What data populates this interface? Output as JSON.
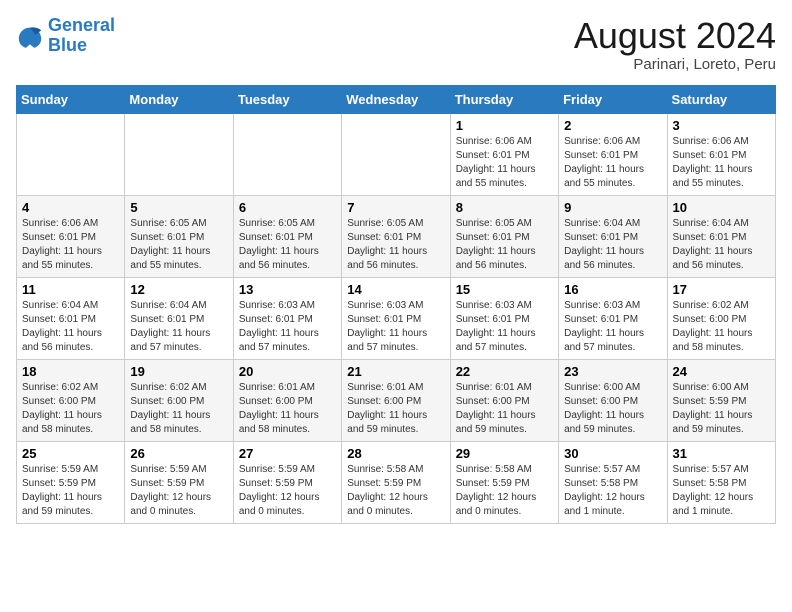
{
  "logo": {
    "line1": "General",
    "line2": "Blue"
  },
  "title": "August 2024",
  "subtitle": "Parinari, Loreto, Peru",
  "days_of_week": [
    "Sunday",
    "Monday",
    "Tuesday",
    "Wednesday",
    "Thursday",
    "Friday",
    "Saturday"
  ],
  "weeks": [
    [
      {
        "day": "",
        "info": ""
      },
      {
        "day": "",
        "info": ""
      },
      {
        "day": "",
        "info": ""
      },
      {
        "day": "",
        "info": ""
      },
      {
        "day": "1",
        "info": "Sunrise: 6:06 AM\nSunset: 6:01 PM\nDaylight: 11 hours\nand 55 minutes."
      },
      {
        "day": "2",
        "info": "Sunrise: 6:06 AM\nSunset: 6:01 PM\nDaylight: 11 hours\nand 55 minutes."
      },
      {
        "day": "3",
        "info": "Sunrise: 6:06 AM\nSunset: 6:01 PM\nDaylight: 11 hours\nand 55 minutes."
      }
    ],
    [
      {
        "day": "4",
        "info": "Sunrise: 6:06 AM\nSunset: 6:01 PM\nDaylight: 11 hours\nand 55 minutes."
      },
      {
        "day": "5",
        "info": "Sunrise: 6:05 AM\nSunset: 6:01 PM\nDaylight: 11 hours\nand 55 minutes."
      },
      {
        "day": "6",
        "info": "Sunrise: 6:05 AM\nSunset: 6:01 PM\nDaylight: 11 hours\nand 56 minutes."
      },
      {
        "day": "7",
        "info": "Sunrise: 6:05 AM\nSunset: 6:01 PM\nDaylight: 11 hours\nand 56 minutes."
      },
      {
        "day": "8",
        "info": "Sunrise: 6:05 AM\nSunset: 6:01 PM\nDaylight: 11 hours\nand 56 minutes."
      },
      {
        "day": "9",
        "info": "Sunrise: 6:04 AM\nSunset: 6:01 PM\nDaylight: 11 hours\nand 56 minutes."
      },
      {
        "day": "10",
        "info": "Sunrise: 6:04 AM\nSunset: 6:01 PM\nDaylight: 11 hours\nand 56 minutes."
      }
    ],
    [
      {
        "day": "11",
        "info": "Sunrise: 6:04 AM\nSunset: 6:01 PM\nDaylight: 11 hours\nand 56 minutes."
      },
      {
        "day": "12",
        "info": "Sunrise: 6:04 AM\nSunset: 6:01 PM\nDaylight: 11 hours\nand 57 minutes."
      },
      {
        "day": "13",
        "info": "Sunrise: 6:03 AM\nSunset: 6:01 PM\nDaylight: 11 hours\nand 57 minutes."
      },
      {
        "day": "14",
        "info": "Sunrise: 6:03 AM\nSunset: 6:01 PM\nDaylight: 11 hours\nand 57 minutes."
      },
      {
        "day": "15",
        "info": "Sunrise: 6:03 AM\nSunset: 6:01 PM\nDaylight: 11 hours\nand 57 minutes."
      },
      {
        "day": "16",
        "info": "Sunrise: 6:03 AM\nSunset: 6:01 PM\nDaylight: 11 hours\nand 57 minutes."
      },
      {
        "day": "17",
        "info": "Sunrise: 6:02 AM\nSunset: 6:00 PM\nDaylight: 11 hours\nand 58 minutes."
      }
    ],
    [
      {
        "day": "18",
        "info": "Sunrise: 6:02 AM\nSunset: 6:00 PM\nDaylight: 11 hours\nand 58 minutes."
      },
      {
        "day": "19",
        "info": "Sunrise: 6:02 AM\nSunset: 6:00 PM\nDaylight: 11 hours\nand 58 minutes."
      },
      {
        "day": "20",
        "info": "Sunrise: 6:01 AM\nSunset: 6:00 PM\nDaylight: 11 hours\nand 58 minutes."
      },
      {
        "day": "21",
        "info": "Sunrise: 6:01 AM\nSunset: 6:00 PM\nDaylight: 11 hours\nand 59 minutes."
      },
      {
        "day": "22",
        "info": "Sunrise: 6:01 AM\nSunset: 6:00 PM\nDaylight: 11 hours\nand 59 minutes."
      },
      {
        "day": "23",
        "info": "Sunrise: 6:00 AM\nSunset: 6:00 PM\nDaylight: 11 hours\nand 59 minutes."
      },
      {
        "day": "24",
        "info": "Sunrise: 6:00 AM\nSunset: 5:59 PM\nDaylight: 11 hours\nand 59 minutes."
      }
    ],
    [
      {
        "day": "25",
        "info": "Sunrise: 5:59 AM\nSunset: 5:59 PM\nDaylight: 11 hours\nand 59 minutes."
      },
      {
        "day": "26",
        "info": "Sunrise: 5:59 AM\nSunset: 5:59 PM\nDaylight: 12 hours\nand 0 minutes."
      },
      {
        "day": "27",
        "info": "Sunrise: 5:59 AM\nSunset: 5:59 PM\nDaylight: 12 hours\nand 0 minutes."
      },
      {
        "day": "28",
        "info": "Sunrise: 5:58 AM\nSunset: 5:59 PM\nDaylight: 12 hours\nand 0 minutes."
      },
      {
        "day": "29",
        "info": "Sunrise: 5:58 AM\nSunset: 5:59 PM\nDaylight: 12 hours\nand 0 minutes."
      },
      {
        "day": "30",
        "info": "Sunrise: 5:57 AM\nSunset: 5:58 PM\nDaylight: 12 hours\nand 1 minute."
      },
      {
        "day": "31",
        "info": "Sunrise: 5:57 AM\nSunset: 5:58 PM\nDaylight: 12 hours\nand 1 minute."
      }
    ]
  ]
}
